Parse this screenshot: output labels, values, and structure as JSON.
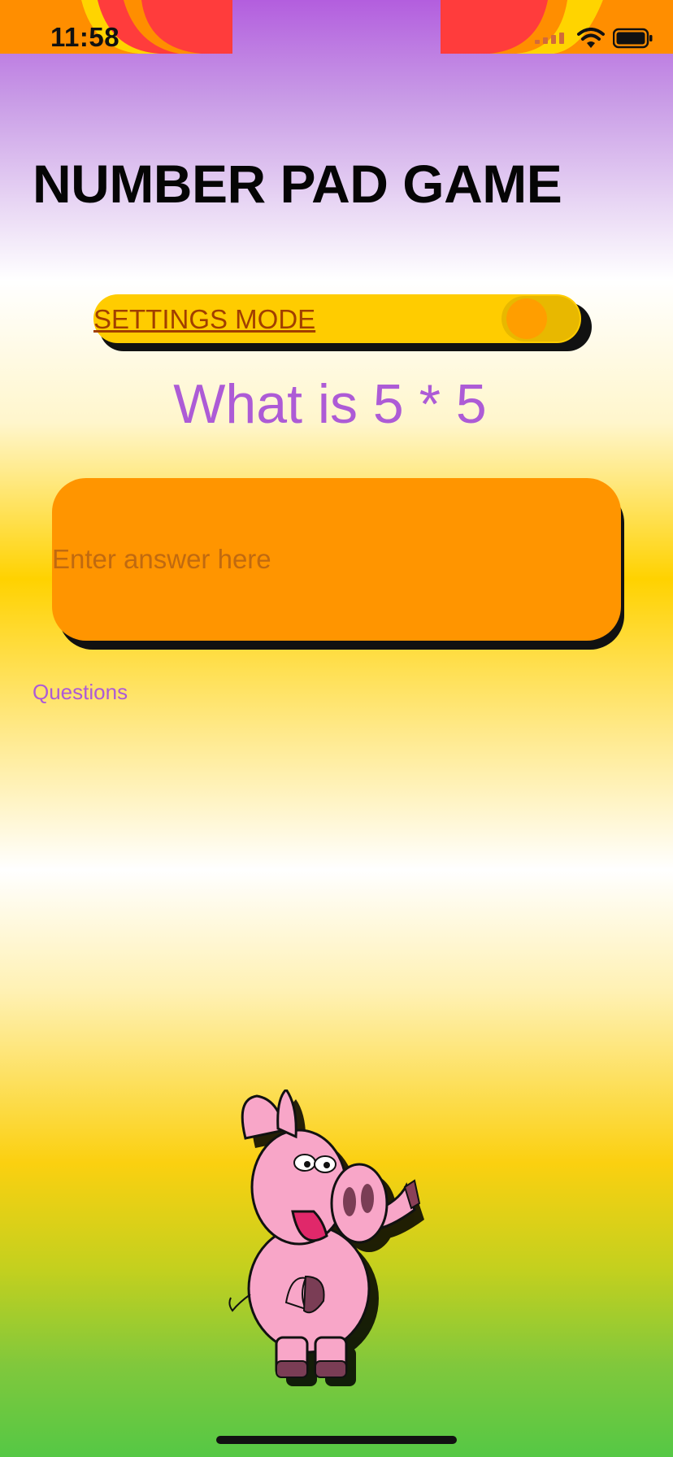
{
  "status_bar": {
    "time": "11:58"
  },
  "title": "NUMBER PAD GAME",
  "settings": {
    "label": "SETTINGS MODE",
    "toggle_on": true
  },
  "question": "What is 5 * 5",
  "answer_input": {
    "placeholder": "Enter answer here",
    "value": ""
  },
  "questions_link": "Questions",
  "colors": {
    "accent_purple": "#ad5bd6",
    "answer_box": "#ff9500",
    "settings_bar": "#ffcc00",
    "settings_label": "#a13f00",
    "toggle_knob": "#ff9e00"
  },
  "icons": [
    "signal-icon",
    "wifi-icon",
    "battery-icon",
    "pig-mascot"
  ]
}
